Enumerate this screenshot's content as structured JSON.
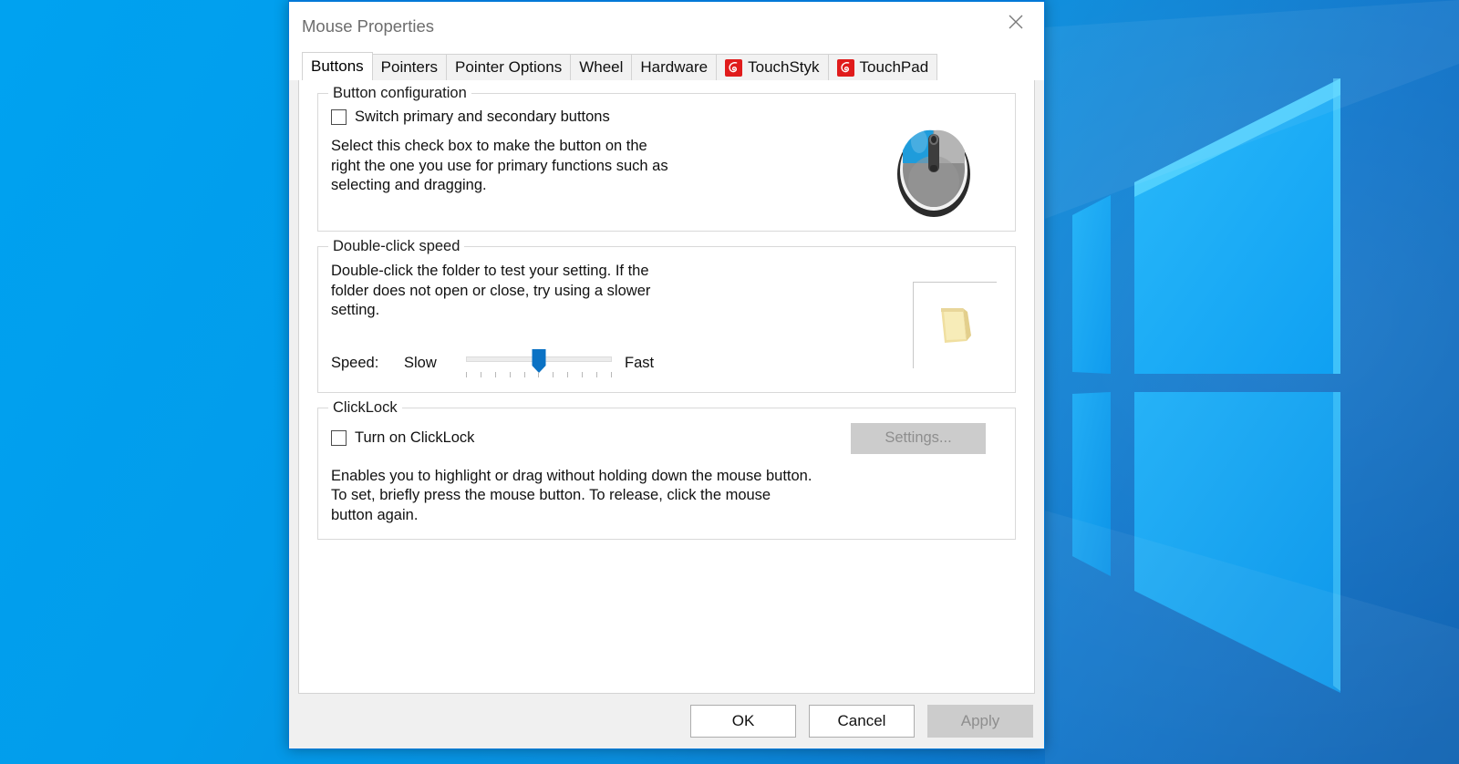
{
  "window": {
    "title": "Mouse Properties",
    "close_icon": "close-icon",
    "accent_color": "#0078d7"
  },
  "tabs": [
    {
      "label": "Buttons",
      "active": true,
      "icon": null
    },
    {
      "label": "Pointers",
      "active": false,
      "icon": null
    },
    {
      "label": "Pointer Options",
      "active": false,
      "icon": null
    },
    {
      "label": "Wheel",
      "active": false,
      "icon": null
    },
    {
      "label": "Hardware",
      "active": false,
      "icon": null
    },
    {
      "label": "TouchStyk",
      "active": false,
      "icon": "synaptics-logo-icon"
    },
    {
      "label": "TouchPad",
      "active": false,
      "icon": "synaptics-logo-icon"
    }
  ],
  "button_configuration": {
    "group_label": "Button configuration",
    "checkbox_label": "Switch primary and secondary buttons",
    "checked": false,
    "description": "Select this check box to make the button on the right the one you use for primary functions such as selecting and dragging.",
    "mouse_icon": "mouse-graphic-icon",
    "mouse_primary_color": "#1f9cdb",
    "mouse_body_color": "#8c8c8c"
  },
  "double_click_speed": {
    "group_label": "Double-click speed",
    "description": "Double-click the folder to test your setting. If the folder does not open or close, try using a slower setting.",
    "speed_label": "Speed:",
    "slow_label": "Slow",
    "fast_label": "Fast",
    "slider_value": 50,
    "slider_min": 0,
    "slider_max": 100,
    "tick_count": 11,
    "thumb_color": "#0b72c4",
    "folder_icon": "folder-icon"
  },
  "clicklock": {
    "group_label": "ClickLock",
    "checkbox_label": "Turn on ClickLock",
    "checked": false,
    "settings_button": "Settings...",
    "settings_disabled": true,
    "description": "Enables you to highlight or drag without holding down the mouse button. To set, briefly press the mouse button. To release, click the mouse button again."
  },
  "footer": {
    "ok_label": "OK",
    "cancel_label": "Cancel",
    "apply_label": "Apply",
    "apply_disabled": true
  }
}
